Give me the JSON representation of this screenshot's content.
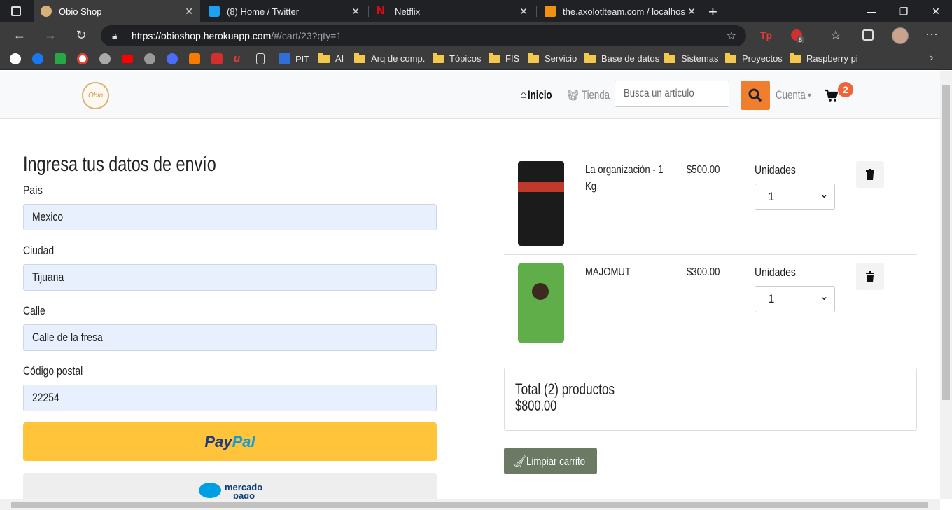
{
  "browser": {
    "tabs": [
      {
        "title": "Obio Shop",
        "active": true
      },
      {
        "title": "(8) Home / Twitter"
      },
      {
        "title": "Netflix"
      },
      {
        "title": "the.axolotlteam.com / localhost /"
      }
    ],
    "url_host": "https://obioshop.herokuapp.com",
    "url_path": "/#/cart/23?qty=1",
    "bookmarks": [
      "PIT",
      "AI",
      "Arq de comp.",
      "Tópicos",
      "FIS",
      "Servicio",
      "Base de datos",
      "Sistemas",
      "Proyectos",
      "Raspberry pi"
    ],
    "ext_badge": "8"
  },
  "site": {
    "logo_text": "Obio",
    "nav": {
      "home": "Inicio",
      "store": "Tienda",
      "account": "Cuenta"
    },
    "search_placeholder": "Busca un articulo",
    "cart_count": "2"
  },
  "shipping": {
    "heading": "Ingresa tus datos de envío",
    "fields": [
      {
        "label": "País",
        "value": "Mexico"
      },
      {
        "label": "Ciudad",
        "value": "Tijuana"
      },
      {
        "label": "Calle",
        "value": "Calle de la fresa"
      },
      {
        "label": "Código postal",
        "value": "22254"
      }
    ],
    "paypal_a": "Pay",
    "paypal_b": "Pal",
    "mercadopago_a": "mercado",
    "mercadopago_b": "pago"
  },
  "cart": {
    "items": [
      {
        "name": "La organización - 1 Kg",
        "price": "$500.00",
        "units_label": "Unidades",
        "qty": "1"
      },
      {
        "name": "MAJOMUT",
        "price": "$300.00",
        "units_label": "Unidades",
        "qty": "1"
      }
    ],
    "total_label": "Total (2) productos",
    "total_value": "$800.00",
    "clear_label": "Limpiar carrito"
  }
}
